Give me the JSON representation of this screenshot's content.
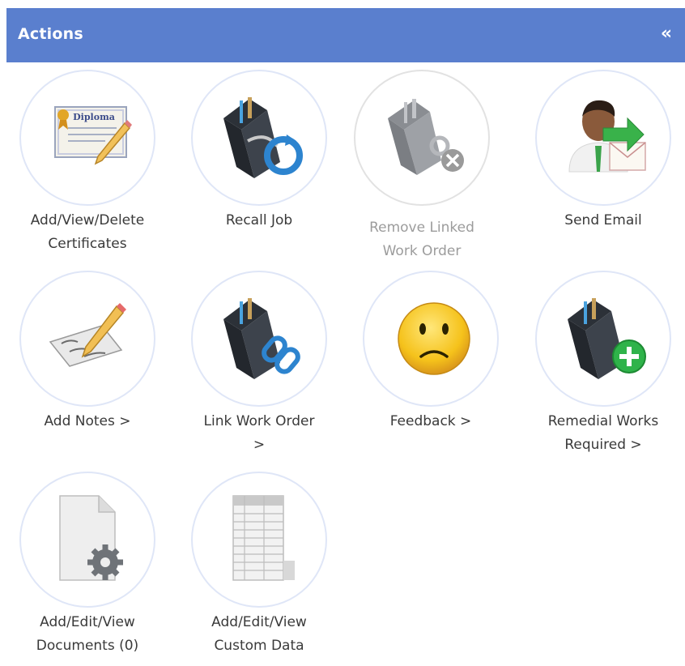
{
  "header": {
    "title": "Actions",
    "collapse_glyph": "«"
  },
  "actions": [
    {
      "line1": "Add/View/Delete",
      "line2": "Certificates",
      "icon": "diploma-icon",
      "enabled": true
    },
    {
      "line1": "Recall Job",
      "line2": "",
      "icon": "toolbox-recall-icon",
      "enabled": true
    },
    {
      "line1": "Remove Linked",
      "line2": "Work Order",
      "icon": "toolbox-unlink-icon",
      "enabled": false
    },
    {
      "line1": "Send Email",
      "line2": "",
      "icon": "person-email-icon",
      "enabled": true
    },
    {
      "line1": "Add Notes >",
      "line2": "",
      "icon": "notes-pencil-icon",
      "enabled": true
    },
    {
      "line1": "Link Work Order",
      "line2": ">",
      "icon": "toolbox-link-icon",
      "enabled": true
    },
    {
      "line1": "Feedback >",
      "line2": "",
      "icon": "sad-face-icon",
      "enabled": true
    },
    {
      "line1": "Remedial Works",
      "line2": "Required >",
      "icon": "toolbox-add-icon",
      "enabled": true
    },
    {
      "line1": "Add/Edit/View",
      "line2": "Documents (0)",
      "icon": "document-gear-icon",
      "enabled": true
    },
    {
      "line1": "Add/Edit/View",
      "line2": "Custom Data",
      "icon": "spreadsheet-icon",
      "enabled": true
    }
  ],
  "diploma_text": "Diploma",
  "colors": {
    "header": "#5a7fce",
    "circle_border": "#dfe6f7",
    "label": "#3a3a3a",
    "disabled_label": "#9c9c9c"
  }
}
